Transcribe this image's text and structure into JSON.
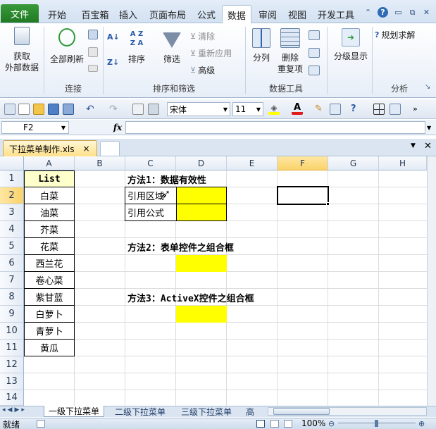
{
  "ribbon_tabs": {
    "file": "文件",
    "home": "开始",
    "baibao": "百宝箱",
    "insert": "插入",
    "layout": "页面布局",
    "formulas": "公式",
    "data": "数据",
    "review": "审阅",
    "view": "视图",
    "developer": "开发工具"
  },
  "ribbon": {
    "get_data_1": "获取",
    "get_data_2": "外部数据",
    "refresh_all": "全部刷新",
    "group_connections": "连接",
    "sort": "排序",
    "filter": "筛选",
    "clear": "清除",
    "reapply": "重新应用",
    "advanced": "高级",
    "group_sort_filter": "排序和筛选",
    "text_to_columns": "分列",
    "remove_dup_1": "删除",
    "remove_dup_2": "重复项",
    "group_data_tools": "数据工具",
    "outline": "分级显示",
    "solver": "规划求解",
    "group_analysis": "分析"
  },
  "toolbar": {
    "font_name": "宋体",
    "font_size": "11"
  },
  "formula_bar": {
    "name_box": "F2",
    "fx": "fx",
    "formula": ""
  },
  "document": {
    "tab_title": "下拉菜单制作.xls",
    "close": "×"
  },
  "grid": {
    "columns": [
      "A",
      "B",
      "C",
      "D",
      "E",
      "F",
      "G",
      "H"
    ],
    "rows": [
      "1",
      "2",
      "3",
      "4",
      "5",
      "6",
      "7",
      "8",
      "9",
      "10",
      "11",
      "12",
      "13",
      "14"
    ],
    "list_header": "List",
    "list_items": [
      "白菜",
      "油菜",
      "芥菜",
      "花菜",
      "西兰花",
      "卷心菜",
      "紫甘蓝",
      "白萝卜",
      "青萝卜",
      "黄瓜"
    ],
    "method1_title": "方法1：数据有效性",
    "method1_row1": "引用区域",
    "method1_row2": "引用公式",
    "method2_title": "方法2：表单控件之组合框",
    "method3_title": "方法3：ActiveX控件之组合框",
    "selected_cell": "F2"
  },
  "sheets": [
    "一级下拉菜单",
    "二级下拉菜单",
    "三级下拉菜单",
    "高"
  ],
  "status": {
    "ready": "就绪",
    "zoom": "100%"
  }
}
